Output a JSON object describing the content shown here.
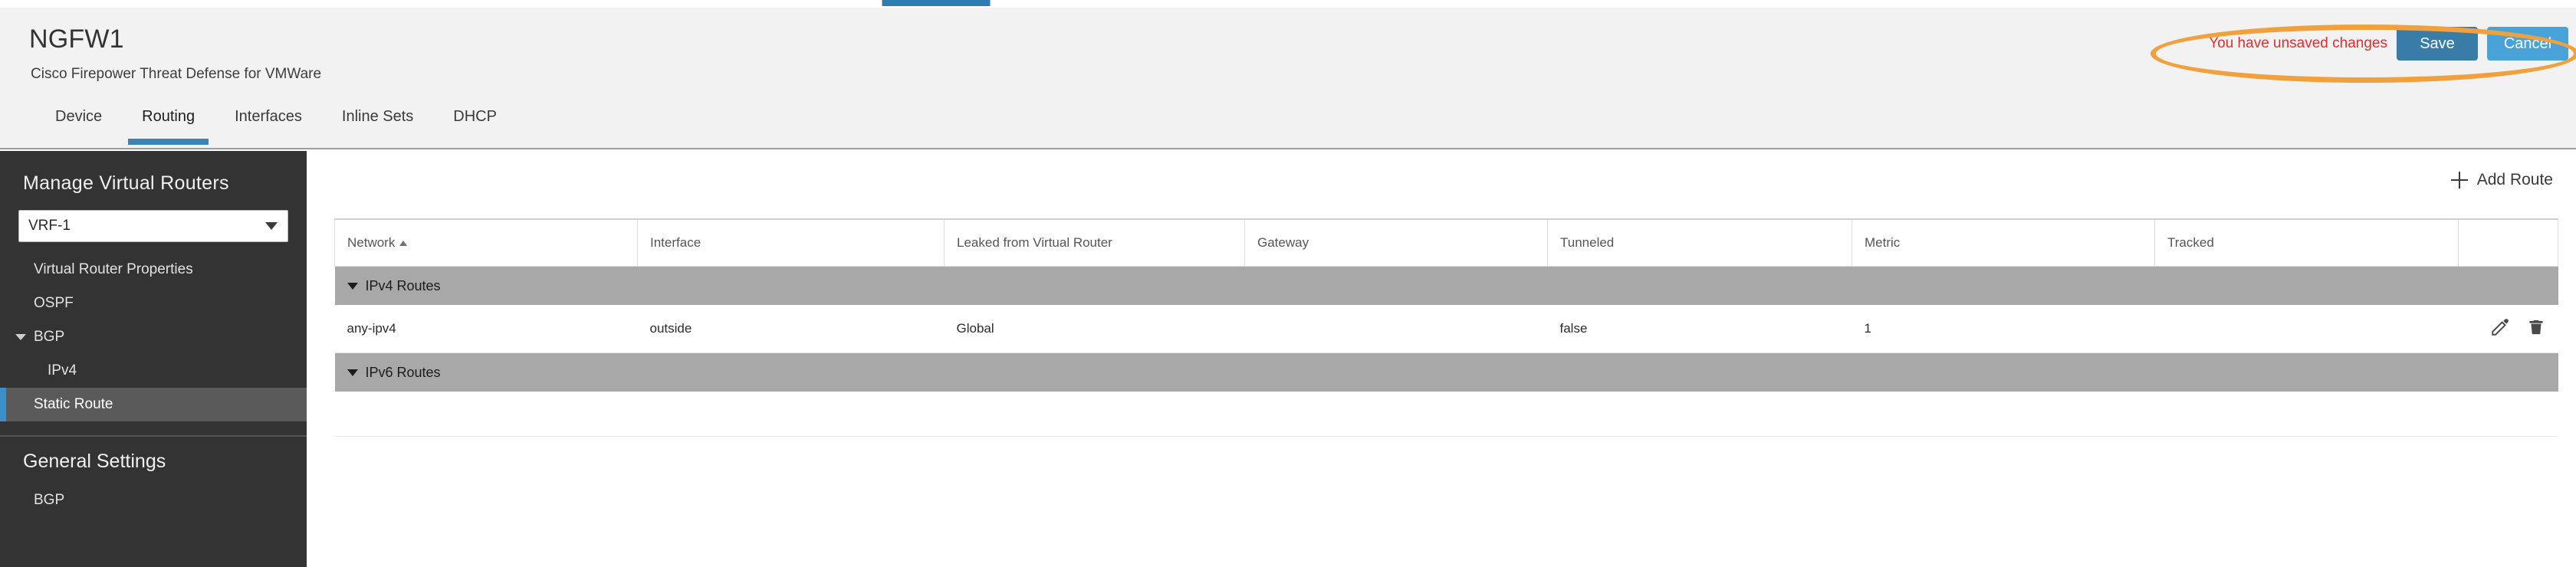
{
  "top_strip": {
    "active_tab_indicator": "active-tab-indicator"
  },
  "header": {
    "device_name": "NGFW1",
    "device_model": "Cisco Firepower Threat Defense for VMWare",
    "unsaved": {
      "message": "You have unsaved changes",
      "save_label": "Save",
      "cancel_label": "Cancel",
      "message_color": "#e02f2f",
      "save_color": "#3a7ca8",
      "cancel_color": "#47a3d8",
      "annotation_color": "#f0a03c"
    },
    "tabs": [
      {
        "label": "Device",
        "active": false
      },
      {
        "label": "Routing",
        "active": true
      },
      {
        "label": "Interfaces",
        "active": false
      },
      {
        "label": "Inline Sets",
        "active": false
      },
      {
        "label": "DHCP",
        "active": false
      }
    ]
  },
  "sidebar": {
    "title": "Manage Virtual Routers",
    "vrf_selected": "VRF-1",
    "caret_icon": "chevron-down-icon",
    "items": [
      {
        "label": "Virtual Router Properties",
        "level": 0,
        "expandable": false,
        "selected": false
      },
      {
        "label": "OSPF",
        "level": 0,
        "expandable": false,
        "selected": false
      },
      {
        "label": "BGP",
        "level": 0,
        "expandable": true,
        "selected": false
      },
      {
        "label": "IPv4",
        "level": 1,
        "expandable": false,
        "selected": false
      },
      {
        "label": "Static Route",
        "level": 0,
        "expandable": false,
        "selected": true
      }
    ],
    "general_settings_title": "General Settings",
    "general_items": [
      {
        "label": "BGP",
        "level": 0,
        "selected": false
      }
    ],
    "selected_accent": "#3b90c9",
    "background": "#333333"
  },
  "main": {
    "add_route_label": "Add Route",
    "add_route_icon": "plus-icon",
    "columns": [
      {
        "label": "Network",
        "sorted": "asc"
      },
      {
        "label": "Interface",
        "sorted": null
      },
      {
        "label": "Leaked from Virtual Router",
        "sorted": null
      },
      {
        "label": "Gateway",
        "sorted": null
      },
      {
        "label": "Tunneled",
        "sorted": null
      },
      {
        "label": "Metric",
        "sorted": null
      },
      {
        "label": "Tracked",
        "sorted": null
      },
      {
        "label": "",
        "sorted": null
      }
    ],
    "groups": [
      {
        "label": "IPv4 Routes",
        "expanded": true,
        "rows": [
          {
            "network": "any-ipv4",
            "interface": "outside",
            "leaked_from_virtual_router": "Global",
            "gateway": "",
            "tunneled": "false",
            "metric": "1",
            "tracked": "",
            "edit_icon": "pencil-icon",
            "delete_icon": "trash-icon"
          }
        ]
      },
      {
        "label": "IPv6 Routes",
        "expanded": true,
        "rows": []
      }
    ]
  }
}
